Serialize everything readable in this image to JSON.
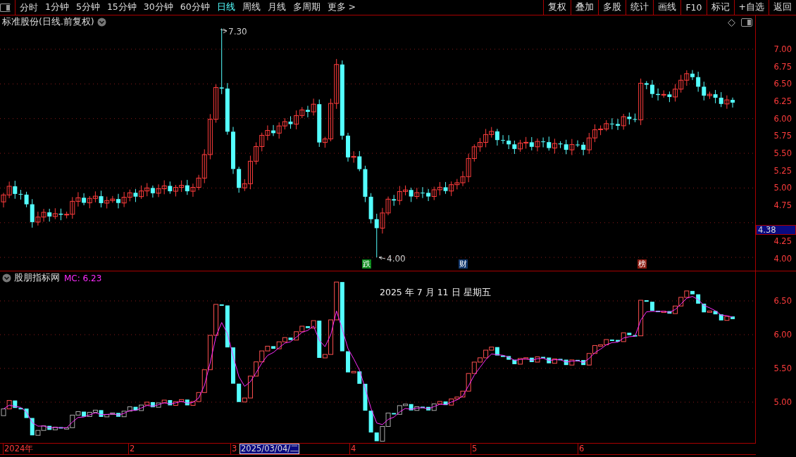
{
  "toolbar": {
    "periods": [
      {
        "label": "分时",
        "selected": false
      },
      {
        "label": "1分钟",
        "selected": false
      },
      {
        "label": "5分钟",
        "selected": false
      },
      {
        "label": "15分钟",
        "selected": false
      },
      {
        "label": "30分钟",
        "selected": false
      },
      {
        "label": "60分钟",
        "selected": false
      },
      {
        "label": "日线",
        "selected": true
      },
      {
        "label": "周线",
        "selected": false
      },
      {
        "label": "月线",
        "selected": false
      },
      {
        "label": "多周期",
        "selected": false
      },
      {
        "label": "更多 >",
        "selected": false
      }
    ],
    "buttons": [
      "复权",
      "叠加",
      "多股",
      "统计",
      "画线",
      "F10",
      "标记",
      "+自选",
      "返回"
    ]
  },
  "main_chart": {
    "title": "标准股份(日线.前复权)",
    "axis_labels": [
      "7.00",
      "6.75",
      "6.50",
      "6.25",
      "6.00",
      "5.75",
      "5.50",
      "5.25",
      "5.00",
      "4.75",
      "4.25",
      "4.00"
    ],
    "current_price": "4.38",
    "high_label": "7.30",
    "low_label": "4.00",
    "events": [
      {
        "label": "跌",
        "color": "#0b8a1c"
      },
      {
        "label": "财",
        "color": "#12386e"
      },
      {
        "label": "榜",
        "color": "#8c1a10"
      }
    ]
  },
  "indicator": {
    "title": "股朋指标网",
    "mc": "MC: 6.23",
    "date": "2025 年 7 月 11 日 星期五",
    "axis_labels": [
      "6.50",
      "6.00",
      "5.50",
      "5.00"
    ]
  },
  "time_axis": [
    {
      "label": "2024年",
      "selected": false
    },
    {
      "label": "2",
      "selected": false
    },
    {
      "label": "3",
      "selected": false
    },
    {
      "label": "2025/03/04/二",
      "selected": true
    },
    {
      "label": "4",
      "selected": false
    },
    {
      "label": "5",
      "selected": false
    },
    {
      "label": "6",
      "selected": false
    }
  ]
}
